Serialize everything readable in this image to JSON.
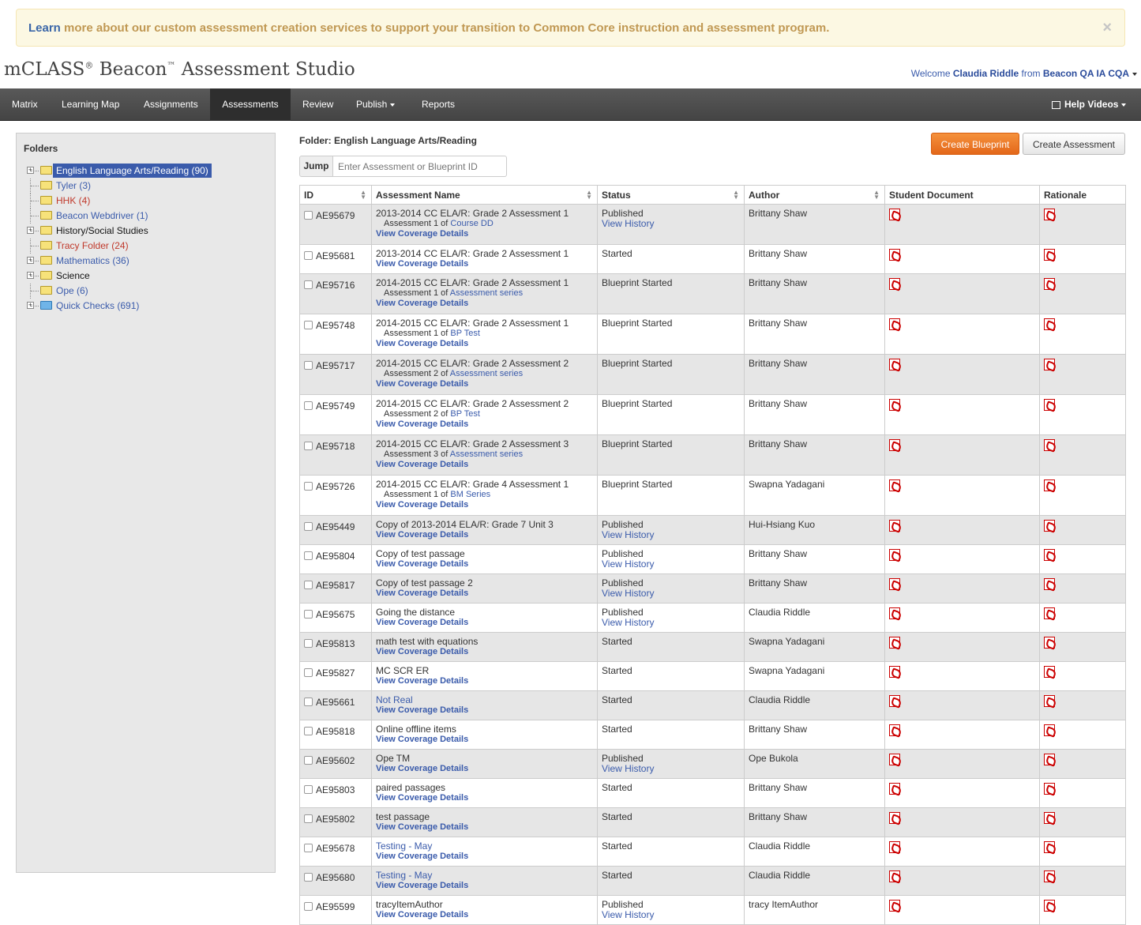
{
  "banner": {
    "link": "Learn",
    "text": "more about our custom assessment creation services to support your transition to Common Core instruction and assessment program.",
    "close": "×"
  },
  "brand": {
    "name": "mCLASS",
    "reg": "®",
    "name2": " Beacon",
    "tm": "™",
    "name3": " Assessment Studio"
  },
  "welcome": {
    "prefix": "Welcome",
    "user": "Claudia Riddle",
    "from": "from",
    "org": "Beacon QA IA CQA"
  },
  "nav": {
    "items": [
      "Matrix",
      "Learning Map",
      "Assignments",
      "Assessments",
      "Review",
      "Publish",
      "Reports"
    ],
    "help": "Help Videos"
  },
  "folders": {
    "title": "Folders",
    "items": [
      {
        "label": "English Language Arts/Reading (90)",
        "color": "sel",
        "exp": true
      },
      {
        "label": "Tyler (3)",
        "color": "blue",
        "exp": false
      },
      {
        "label": "HHK (4)",
        "color": "red",
        "exp": false
      },
      {
        "label": "Beacon Webdriver (1)",
        "color": "blue",
        "exp": false
      },
      {
        "label": "History/Social Studies",
        "color": "black",
        "exp": true
      },
      {
        "label": "Tracy Folder (24)",
        "color": "red",
        "exp": false
      },
      {
        "label": "Mathematics (36)",
        "color": "blue",
        "exp": true
      },
      {
        "label": "Science",
        "color": "black",
        "exp": true
      },
      {
        "label": "Ope (6)",
        "color": "blue",
        "exp": false
      },
      {
        "label": "Quick Checks (691)",
        "color": "blue",
        "exp": true,
        "bluefolder": true
      }
    ]
  },
  "main": {
    "folder_title": "Folder: English Language Arts/Reading",
    "create_blueprint": "Create Blueprint",
    "create_assessment": "Create Assessment",
    "jump_label": "Jump",
    "jump_placeholder": "Enter Assessment or Blueprint ID"
  },
  "table": {
    "headers": [
      "ID",
      "Assessment Name",
      "Status",
      "Author",
      "Student Document",
      "Rationale"
    ],
    "coverage": "View Coverage Details",
    "history": "View History",
    "rows": [
      {
        "id": "AE95679",
        "name": "2013-2014 CC ELA/R: Grade 2 Assessment 1",
        "sub_pre": "Assessment 1 of",
        "sub_link": "Course DD",
        "status": "Published",
        "hist": true,
        "author": "Brittany Shaw",
        "h": 51
      },
      {
        "id": "AE95681",
        "name": "2013-2014 CC ELA/R: Grade 2 Assessment 1",
        "status": "Started",
        "author": "Brittany Shaw",
        "h": 37
      },
      {
        "id": "AE95716",
        "name": "2014-2015 CC ELA/R: Grade 2 Assessment 1",
        "sub_pre": "Assessment 1 of",
        "sub_link": "Assessment series",
        "status": "Blueprint Started",
        "author": "Brittany Shaw",
        "h": 51
      },
      {
        "id": "AE95748",
        "name": "2014-2015 CC ELA/R: Grade 2 Assessment 1",
        "sub_pre": "Assessment 1 of",
        "sub_link": "BP Test",
        "status": "Blueprint Started",
        "author": "Brittany Shaw",
        "h": 51
      },
      {
        "id": "AE95717",
        "name": "2014-2015 CC ELA/R: Grade 2 Assessment 2",
        "sub_pre": "Assessment 2 of",
        "sub_link": "Assessment series",
        "status": "Blueprint Started",
        "author": "Brittany Shaw",
        "h": 51
      },
      {
        "id": "AE95749",
        "name": "2014-2015 CC ELA/R: Grade 2 Assessment 2",
        "sub_pre": "Assessment 2 of",
        "sub_link": "BP Test",
        "status": "Blueprint Started",
        "author": "Brittany Shaw",
        "h": 51
      },
      {
        "id": "AE95718",
        "name": "2014-2015 CC ELA/R: Grade 2 Assessment 3",
        "sub_pre": "Assessment 3 of",
        "sub_link": "Assessment series",
        "status": "Blueprint Started",
        "author": "Brittany Shaw",
        "h": 51
      },
      {
        "id": "AE95726",
        "name": "2014-2015 CC ELA/R: Grade 4 Assessment 1",
        "sub_pre": "Assessment 1 of",
        "sub_link": "BM Series",
        "status": "Blueprint Started",
        "author": "Swapna Yadagani",
        "h": 51
      },
      {
        "id": "AE95449",
        "name": "Copy of 2013-2014 ELA/R: Grade 7 Unit 3",
        "status": "Published",
        "hist": true,
        "author": "Hui-Hsiang Kuo",
        "h": 37
      },
      {
        "id": "AE95804",
        "name": "Copy of test passage",
        "status": "Published",
        "hist": true,
        "author": "Brittany Shaw",
        "h": 37
      },
      {
        "id": "AE95817",
        "name": "Copy of test passage 2",
        "status": "Published",
        "hist": true,
        "author": "Brittany Shaw",
        "h": 37
      },
      {
        "id": "AE95675",
        "name": "Going the distance",
        "status": "Published",
        "hist": true,
        "author": "Claudia Riddle",
        "h": 37
      },
      {
        "id": "AE95813",
        "name": "math test with equations",
        "status": "Started",
        "author": "Swapna Yadagani",
        "h": 37
      },
      {
        "id": "AE95827",
        "name": "MC SCR ER",
        "status": "Started",
        "author": "Swapna Yadagani",
        "h": 37
      },
      {
        "id": "AE95661",
        "name": "Not Real",
        "link": true,
        "status": "Started",
        "author": "Claudia Riddle",
        "h": 37
      },
      {
        "id": "AE95818",
        "name": "Online offline items",
        "status": "Started",
        "author": "Brittany Shaw",
        "h": 37
      },
      {
        "id": "AE95602",
        "name": "Ope TM",
        "status": "Published",
        "hist": true,
        "author": "Ope Bukola",
        "h": 37
      },
      {
        "id": "AE95803",
        "name": "paired passages",
        "status": "Started",
        "author": "Brittany Shaw",
        "h": 37
      },
      {
        "id": "AE95802",
        "name": "test passage",
        "status": "Started",
        "author": "Brittany Shaw",
        "h": 37
      },
      {
        "id": "AE95678",
        "name": "Testing - May",
        "link": true,
        "status": "Started",
        "author": "Claudia Riddle",
        "h": 37
      },
      {
        "id": "AE95680",
        "name": "Testing - May",
        "link": true,
        "status": "Started",
        "author": "Claudia Riddle",
        "h": 37
      },
      {
        "id": "AE95599",
        "name": "tracyItemAuthor",
        "status": "Published",
        "hist": true,
        "author": "tracy ItemAuthor",
        "h": 37
      }
    ]
  }
}
